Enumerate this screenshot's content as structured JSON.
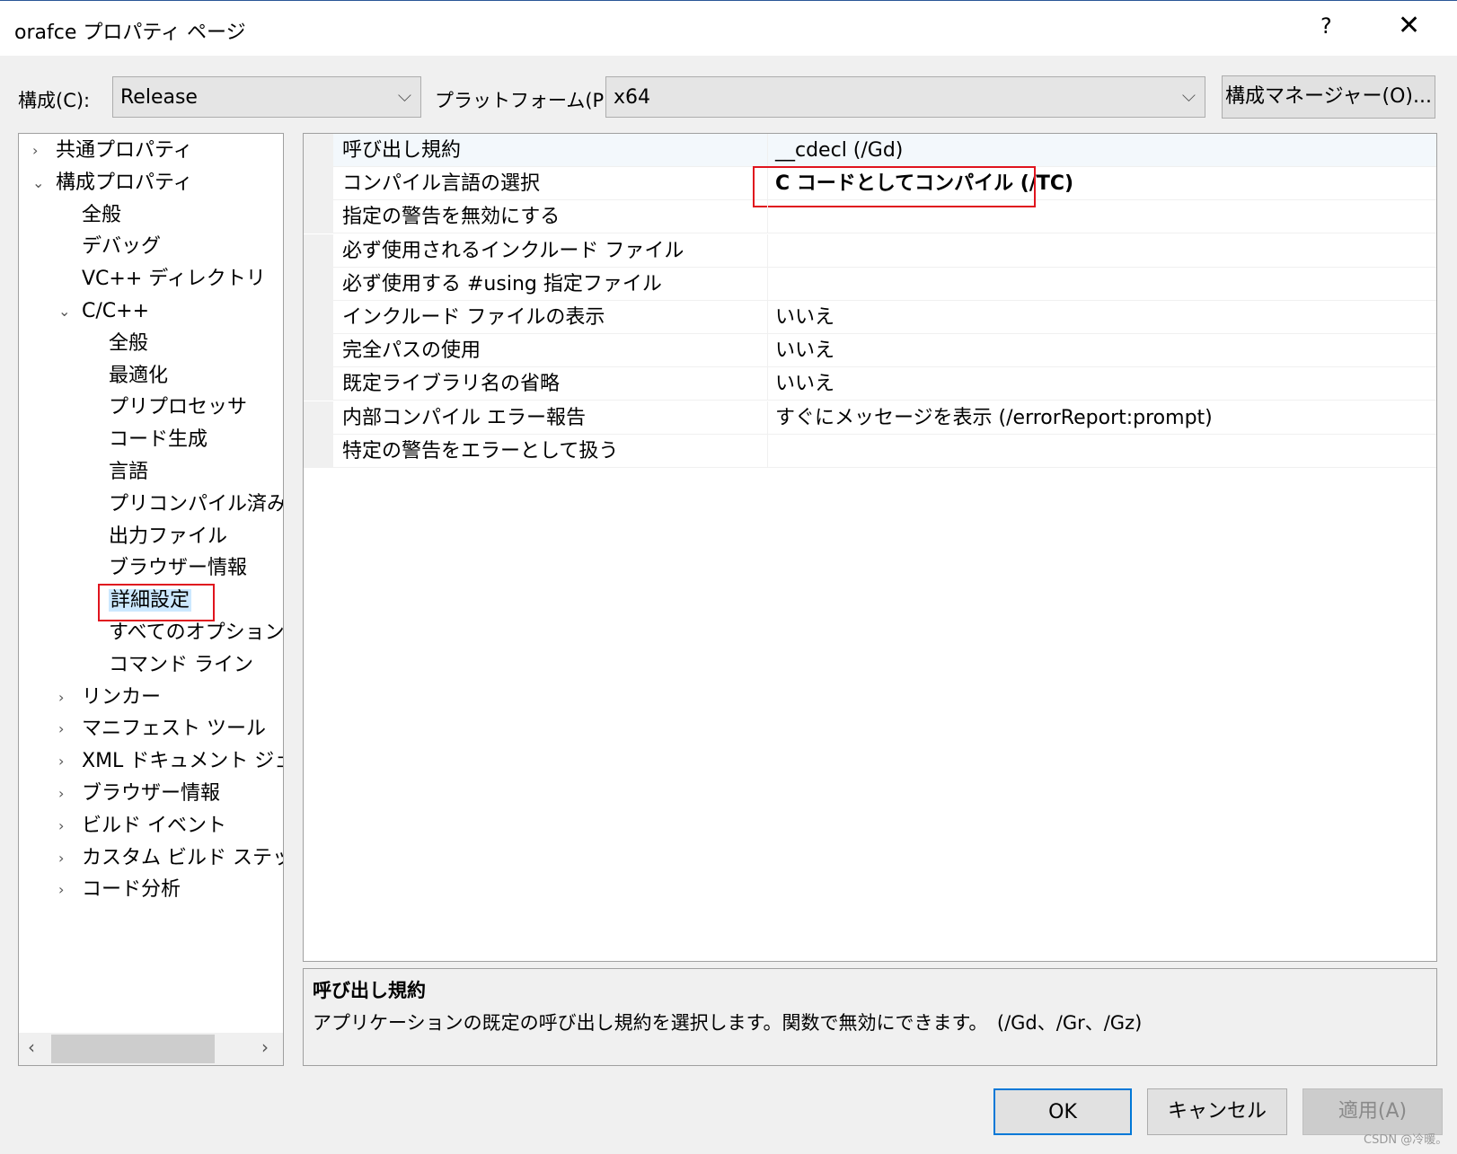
{
  "window": {
    "title": "orafce プロパティ ページ",
    "help": "?",
    "close": "✕"
  },
  "toolbar": {
    "config_label": "構成(C):",
    "config_value": "Release",
    "platform_label": "プラットフォーム(P):",
    "platform_value": "x64",
    "config_manager": "構成マネージャー(O)..."
  },
  "tree": [
    {
      "label": "共通プロパティ",
      "level": 0,
      "arrow": "›"
    },
    {
      "label": "構成プロパティ",
      "level": 0,
      "arrow": "⌄"
    },
    {
      "label": "全般",
      "level": 1,
      "arrow": ""
    },
    {
      "label": "デバッグ",
      "level": 1,
      "arrow": ""
    },
    {
      "label": "VC++ ディレクトリ",
      "level": 1,
      "arrow": ""
    },
    {
      "label": "C/C++",
      "level": 1,
      "arrow": "⌄"
    },
    {
      "label": "全般",
      "level": 2,
      "arrow": ""
    },
    {
      "label": "最適化",
      "level": 2,
      "arrow": ""
    },
    {
      "label": "プリプロセッサ",
      "level": 2,
      "arrow": ""
    },
    {
      "label": "コード生成",
      "level": 2,
      "arrow": ""
    },
    {
      "label": "言語",
      "level": 2,
      "arrow": ""
    },
    {
      "label": "プリコンパイル済みヘッダー",
      "level": 2,
      "arrow": ""
    },
    {
      "label": "出力ファイル",
      "level": 2,
      "arrow": ""
    },
    {
      "label": "ブラウザー情報",
      "level": 2,
      "arrow": ""
    },
    {
      "label": "詳細設定",
      "level": 2,
      "arrow": "",
      "selected": true
    },
    {
      "label": "すべてのオプション",
      "level": 2,
      "arrow": ""
    },
    {
      "label": "コマンド ライン",
      "level": 2,
      "arrow": ""
    },
    {
      "label": "リンカー",
      "level": 1,
      "arrow": "›"
    },
    {
      "label": "マニフェスト ツール",
      "level": 1,
      "arrow": "›"
    },
    {
      "label": "XML ドキュメント ジェネレーター",
      "level": 1,
      "arrow": "›"
    },
    {
      "label": "ブラウザー情報",
      "level": 1,
      "arrow": "›"
    },
    {
      "label": "ビルド イベント",
      "level": 1,
      "arrow": "›"
    },
    {
      "label": "カスタム ビルド ステップ",
      "level": 1,
      "arrow": "›"
    },
    {
      "label": "コード分析",
      "level": 1,
      "arrow": "›"
    }
  ],
  "properties": [
    {
      "name": "呼び出し規約",
      "value": "__cdecl (/Gd)"
    },
    {
      "name": "コンパイル言語の選択",
      "value": "C コードとしてコンパイル (/TC)",
      "bold": true
    },
    {
      "name": "指定の警告を無効にする",
      "value": ""
    },
    {
      "name": "必ず使用されるインクルード ファイル",
      "value": ""
    },
    {
      "name": "必ず使用する #using 指定ファイル",
      "value": ""
    },
    {
      "name": "インクルード ファイルの表示",
      "value": "いいえ"
    },
    {
      "name": "完全パスの使用",
      "value": "いいえ"
    },
    {
      "name": "既定ライブラリ名の省略",
      "value": "いいえ"
    },
    {
      "name": "内部コンパイル エラー報告",
      "value": "すぐにメッセージを表示 (/errorReport:prompt)"
    },
    {
      "name": "特定の警告をエラーとして扱う",
      "value": ""
    }
  ],
  "description": {
    "title": "呼び出し規約",
    "text": "アプリケーションの既定の呼び出し規約を選択します。関数で無効にできます。　(/Gd、/Gr、/Gz)"
  },
  "buttons": {
    "ok": "OK",
    "cancel": "キャンセル",
    "apply": "適用(A)"
  },
  "watermark": "CSDN @冷暖。",
  "colors": {
    "highlight": "#e0141e",
    "selection": "#cce8ff",
    "focus": "#0078d7"
  }
}
